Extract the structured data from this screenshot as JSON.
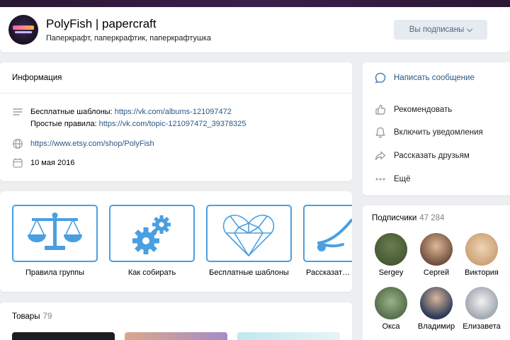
{
  "header": {
    "title": "PolyFish | papercraft",
    "status": "Паперкрафт, паперкрафтик, паперкрафтушка",
    "subscribe_label": "Вы подписаны"
  },
  "info": {
    "heading": "Информация",
    "desc_line1_label": "Бесплатные шаблоны: ",
    "desc_line1_link": "https://vk.com/albums-121097472",
    "desc_line2_label": "Простые правила: ",
    "desc_line2_link": "https://vk.com/topic-121097472_39378325",
    "website": "https://www.etsy.com/shop/PolyFish",
    "date": "10 мая 2016"
  },
  "actions": {
    "items": [
      {
        "label": "Написать сообщение",
        "icon": "message-icon"
      },
      {
        "label": "Рекомендовать",
        "icon": "thumbs-up-icon"
      },
      {
        "label": "Включить уведомления",
        "icon": "bell-icon"
      },
      {
        "label": "Рассказать друзьям",
        "icon": "share-icon"
      },
      {
        "label": "Ещё",
        "icon": "more-icon"
      }
    ]
  },
  "links": {
    "items": [
      {
        "label": "Правила группы",
        "icon": "scales-icon"
      },
      {
        "label": "Как собирать",
        "icon": "gears-icon"
      },
      {
        "label": "Бесплатные шаблоны",
        "icon": "poly-heart-icon"
      },
      {
        "label": "Рассказать друзьям",
        "icon": "share-arrow-icon"
      }
    ]
  },
  "goods": {
    "heading": "Товары",
    "count": "79"
  },
  "subscribers": {
    "heading": "Подписчики",
    "count": "47 284",
    "members": [
      {
        "name": "Sergey",
        "color": "#4a5a3a"
      },
      {
        "name": "Сергей",
        "color": "#c9a07e"
      },
      {
        "name": "Виктория",
        "color": "#d8b98f"
      },
      {
        "name": "Окса",
        "color": "#6b8a5a"
      },
      {
        "name": "Владимир",
        "color": "#3b4a66"
      },
      {
        "name": "Елизавета",
        "color": "#bfc5cc"
      }
    ]
  },
  "colors": {
    "link": "#2a5885",
    "accent_blue": "#4a9fe0",
    "subscribe_bg": "#e5ebf1"
  }
}
